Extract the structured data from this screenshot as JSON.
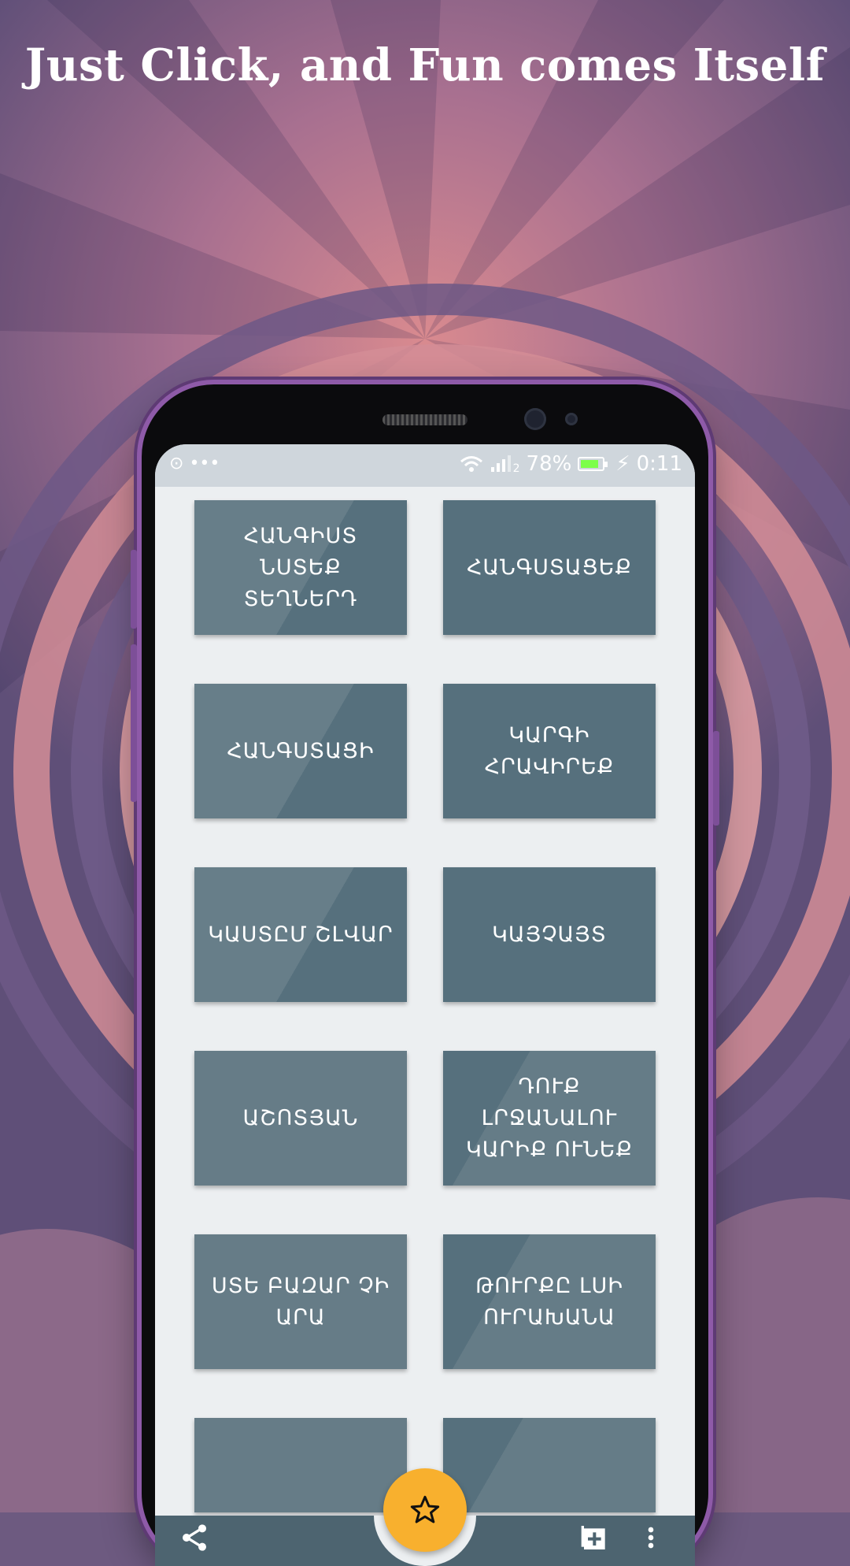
{
  "headline": "Just Click, and Fun comes Itself",
  "status_bar": {
    "notification_icons": "•••",
    "battery_percent": "78%",
    "time": "0:11",
    "sim_label": "2"
  },
  "cards": [
    {
      "label": "ՀԱՆԳԻՍՏ ՆՍՏԵՔ ՏԵՂՆԵՐԴ"
    },
    {
      "label": "ՀԱՆԳՍՏԱՑԵՔ"
    },
    {
      "label": "ՀԱՆԳՍՏԱՑԻ"
    },
    {
      "label": "ԿԱՐԳԻ ՀՐԱՎԻՐԵՔ"
    },
    {
      "label": "ԿԱՍՏԸՄ ՇԼՎԱՐ"
    },
    {
      "label": "ԿԱՅՉԱՅՏ"
    },
    {
      "label": "ԱՇՈՏՅԱՆ"
    },
    {
      "label": "ԴՈՒՔ ԼՐՋԱՆԱԼՈՒ ԿԱՐԻՔ ՈՒՆԵՔ"
    },
    {
      "label": "ՍՏԵ ԲԱԶԱՐ ՉԻ ԱՐԱ"
    },
    {
      "label": "ԹՈՒՐՔԸ ԼՍԻ ՈՒՐԱԽԱՆԱ"
    }
  ],
  "icons": {
    "fab": "star-icon",
    "left": "share-icon",
    "right": "add-playlist-icon",
    "overflow": "more-vert-icon"
  },
  "colors": {
    "card": "#56707d",
    "fab": "#f8b02e",
    "bottom_bar": "#4d6470",
    "screen_bg": "#eceff1"
  }
}
